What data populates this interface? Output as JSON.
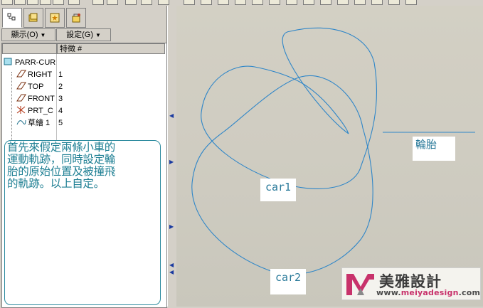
{
  "toolbar": {
    "view_menu_label": "顯示(O)",
    "settings_menu_label": "設定(G)"
  },
  "model_tree": {
    "root": "PARR-CUR",
    "column_header": "特徵 #",
    "items": [
      {
        "label": "RIGHT",
        "feature_no": "1",
        "icon": "datum-plane-icon"
      },
      {
        "label": "TOP",
        "feature_no": "2",
        "icon": "datum-plane-icon"
      },
      {
        "label": "FRONT",
        "feature_no": "3",
        "icon": "datum-plane-icon"
      },
      {
        "label": "PRT_C",
        "feature_no": "4",
        "icon": "coordinate-system-icon"
      },
      {
        "label": "草繪 1",
        "feature_no": "5",
        "icon": "sketch-icon"
      }
    ]
  },
  "note": {
    "lines": [
      "首先來假定兩條小車的",
      "運動軌跡，同時設定輪",
      "胎的原始位置及被撞飛",
      "的軌跡。以上自定。"
    ]
  },
  "canvas": {
    "labels": {
      "tire": "輪胎",
      "car1": "car1",
      "car2": "car2"
    },
    "curve_color": "#2f86c8"
  },
  "watermark": {
    "brand": "美雅設計",
    "url_prefix": "www.",
    "url_name": "meiyadesign",
    "url_suffix": ".com"
  }
}
